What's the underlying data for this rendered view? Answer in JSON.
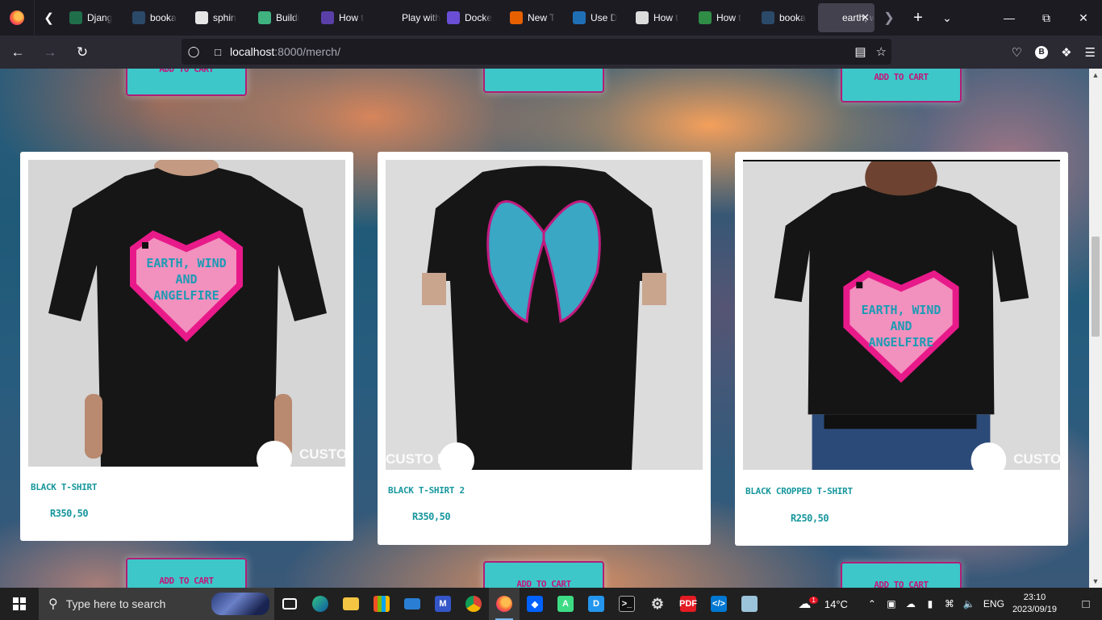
{
  "browser": {
    "tabs": [
      {
        "label": "Djang",
        "icon": "w-icon",
        "color": "#1f6f4a"
      },
      {
        "label": "booka",
        "icon": "globe-icon",
        "color": "#2b4a6a"
      },
      {
        "label": "sphin",
        "icon": "sphinx-icon",
        "color": "#e6e6e6"
      },
      {
        "label": "Buildi",
        "icon": "play-icon",
        "color": "#3fb27f"
      },
      {
        "label": "How t",
        "icon": "book-icon",
        "color": "#5b3fa8"
      },
      {
        "label": "Play with D",
        "icon": "blank-icon",
        "color": "#1c1b22"
      },
      {
        "label": "Docke",
        "icon": "a-icon",
        "color": "#6a4fd6"
      },
      {
        "label": "New T",
        "icon": "firefox-icon",
        "color": "#e66000"
      },
      {
        "label": "Use D",
        "icon": "edge-icon",
        "color": "#1f6fb5"
      },
      {
        "label": "How t",
        "icon": "chart-icon",
        "color": "#dcdcdc"
      },
      {
        "label": "How t",
        "icon": "gfg-icon",
        "color": "#2f8d46"
      },
      {
        "label": "booka",
        "icon": "globe-icon",
        "color": "#2b4a6a"
      },
      {
        "label": "earth, w",
        "icon": "page-icon",
        "color": "#42414d",
        "active": true
      }
    ],
    "url_host": "localhost",
    "url_rest": ":8000/merch/"
  },
  "page": {
    "add_to_cart_label": "ADD TO CART",
    "products": [
      {
        "name": "BLACK T-SHIRT",
        "price": "R350,50",
        "heart_text": [
          "EARTH, WIND",
          "AND",
          "ANGELFIRE"
        ]
      },
      {
        "name": "BLACK T-SHIRT 2",
        "price": "R350,50"
      },
      {
        "name": "BLACK CROPPED T-SHIRT",
        "price": "R250,50",
        "heart_text": [
          "EARTH, WIND",
          "AND",
          "ANGELFIRE"
        ]
      }
    ],
    "watermark": "CUSTO INK"
  },
  "taskbar": {
    "search_placeholder": "Type here to search",
    "weather_temp": "14°C",
    "weather_badge": "1",
    "language": "ENG",
    "time": "23:10",
    "date": "2023/09/19"
  },
  "colors": {
    "button_bg": "#3dc7c9",
    "button_text": "#c2177a",
    "product_text": "#17979d"
  }
}
